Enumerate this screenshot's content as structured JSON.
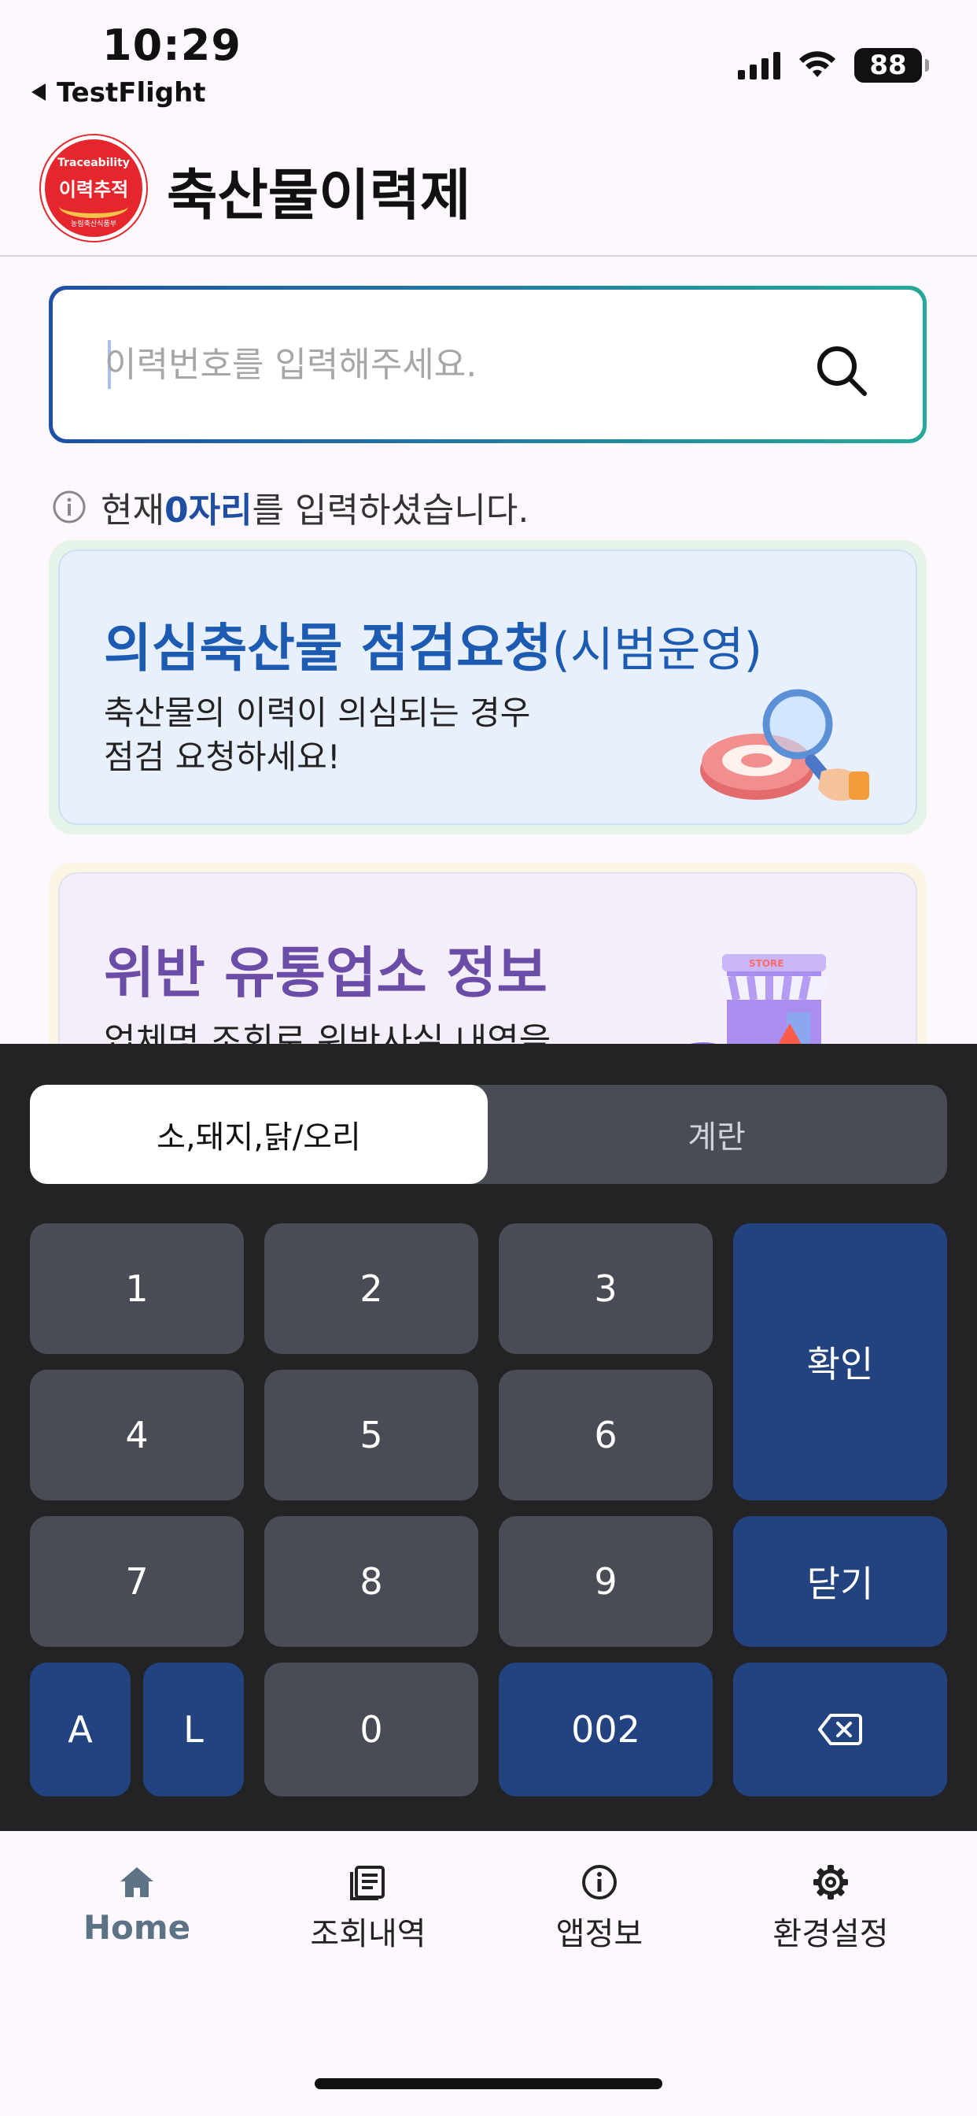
{
  "status_bar": {
    "time": "10:29",
    "back_app": "TestFlight",
    "battery": "88"
  },
  "header": {
    "title": "축산물이력제",
    "logo": {
      "top_text": "Traceability",
      "main_text": "이력추적",
      "sub_text": "농림축산식품부"
    }
  },
  "search": {
    "placeholder": "이력번호를 입력해주세요.",
    "value": ""
  },
  "hint": {
    "prefix": "현재 ",
    "count": "0자리",
    "suffix": "를 입력하셨습니다."
  },
  "cards": [
    {
      "title": "의심축산물 점검요청",
      "title_sub": "(시범운영)",
      "desc_line1": "축산물의 이력이 의심되는 경우",
      "desc_line2": "점검 요청하세요!"
    },
    {
      "title": "위반 유통업소 정보",
      "desc_line1": "업체명 조회로 위반사실 내역을",
      "store_sign": "STORE"
    }
  ],
  "keypad": {
    "segments": [
      {
        "label": "소,돼지,닭/오리",
        "active": true
      },
      {
        "label": "계란",
        "active": false
      }
    ],
    "keys": {
      "k1": "1",
      "k2": "2",
      "k3": "3",
      "k4": "4",
      "k5": "5",
      "k6": "6",
      "k7": "7",
      "k8": "8",
      "k9": "9",
      "kA": "A",
      "kL": "L",
      "k0": "0",
      "k002": "002",
      "confirm": "확인",
      "close": "닫기"
    },
    "colors": {
      "background": "#232325",
      "gray_key": "#4a4c55",
      "blue_key": "#224380"
    }
  },
  "tabs": [
    {
      "label": "Home",
      "icon": "home-icon",
      "active": true
    },
    {
      "label": "조회내역",
      "icon": "list-icon",
      "active": false
    },
    {
      "label": "앱정보",
      "icon": "info-icon",
      "active": false
    },
    {
      "label": "환경설정",
      "icon": "gear-icon",
      "active": false
    }
  ],
  "colors": {
    "brand_blue": "#1d5ab2",
    "brand_purple": "#6b4da8",
    "active_tab": "#5c7285"
  }
}
